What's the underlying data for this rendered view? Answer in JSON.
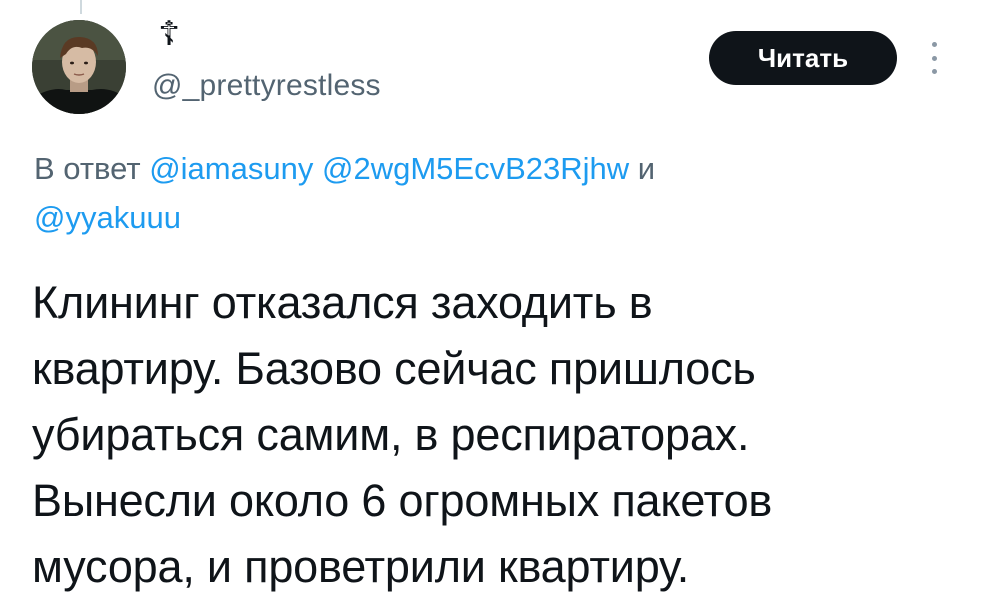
{
  "author": {
    "display_name": "☦",
    "handle": "@_prettyrestless",
    "avatar_icon": "profile-photo"
  },
  "follow_button": {
    "label": "Читать"
  },
  "more_icon": "more-vertical-icon",
  "reply_context": {
    "prefix": "В ответ",
    "mentions": [
      "@iamasuny",
      "@2wgM5EcvB23Rjhw",
      "@yyakuuu"
    ],
    "conjunction": "и"
  },
  "tweet": {
    "lines": [
      "Клининг отказался заходить в",
      "квартиру. Базово сейчас пришлось",
      "убираться самим, в респираторах.",
      "Вынесли около 6 огромных пакетов",
      "мусора, и проветрили квартиру."
    ]
  },
  "colors": {
    "text": "#0f1419",
    "secondary": "#536471",
    "link": "#1d9bf0",
    "button_bg": "#0f1419",
    "button_text": "#ffffff"
  }
}
